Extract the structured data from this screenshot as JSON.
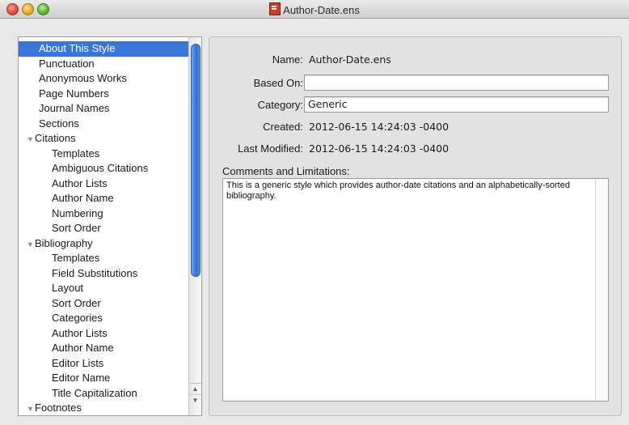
{
  "window": {
    "title": "Author-Date.ens"
  },
  "sidebar": {
    "items": [
      {
        "label": "About This Style",
        "kind": "top",
        "selected": true
      },
      {
        "label": "Punctuation",
        "kind": "top"
      },
      {
        "label": "Anonymous Works",
        "kind": "top"
      },
      {
        "label": "Page Numbers",
        "kind": "top"
      },
      {
        "label": "Journal Names",
        "kind": "top"
      },
      {
        "label": "Sections",
        "kind": "top"
      },
      {
        "label": "Citations",
        "kind": "group"
      },
      {
        "label": "Templates",
        "kind": "child"
      },
      {
        "label": "Ambiguous Citations",
        "kind": "child"
      },
      {
        "label": "Author Lists",
        "kind": "child"
      },
      {
        "label": "Author Name",
        "kind": "child"
      },
      {
        "label": "Numbering",
        "kind": "child"
      },
      {
        "label": "Sort Order",
        "kind": "child"
      },
      {
        "label": "Bibliography",
        "kind": "group"
      },
      {
        "label": "Templates",
        "kind": "child"
      },
      {
        "label": "Field Substitutions",
        "kind": "child"
      },
      {
        "label": "Layout",
        "kind": "child"
      },
      {
        "label": "Sort Order",
        "kind": "child"
      },
      {
        "label": "Categories",
        "kind": "child"
      },
      {
        "label": "Author Lists",
        "kind": "child"
      },
      {
        "label": "Author Name",
        "kind": "child"
      },
      {
        "label": "Editor Lists",
        "kind": "child"
      },
      {
        "label": "Editor Name",
        "kind": "child"
      },
      {
        "label": "Title Capitalization",
        "kind": "child"
      },
      {
        "label": "Footnotes",
        "kind": "group"
      }
    ]
  },
  "details": {
    "name_label": "Name:",
    "name_value": "Author-Date.ens",
    "based_on_label": "Based On:",
    "based_on_value": "",
    "category_label": "Category:",
    "category_value": "Generic",
    "created_label": "Created:",
    "created_value": "2012-06-15 14:24:03 -0400",
    "modified_label": "Last Modified:",
    "modified_value": "2012-06-15 14:24:03 -0400",
    "comments_label": "Comments and Limitations:",
    "comments_value": "This is a generic style which provides author-date citations and an alphabetically-sorted bibliography."
  },
  "colors": {
    "selection": "#3875d7",
    "scroll_thumb": "#2f6fd1"
  }
}
